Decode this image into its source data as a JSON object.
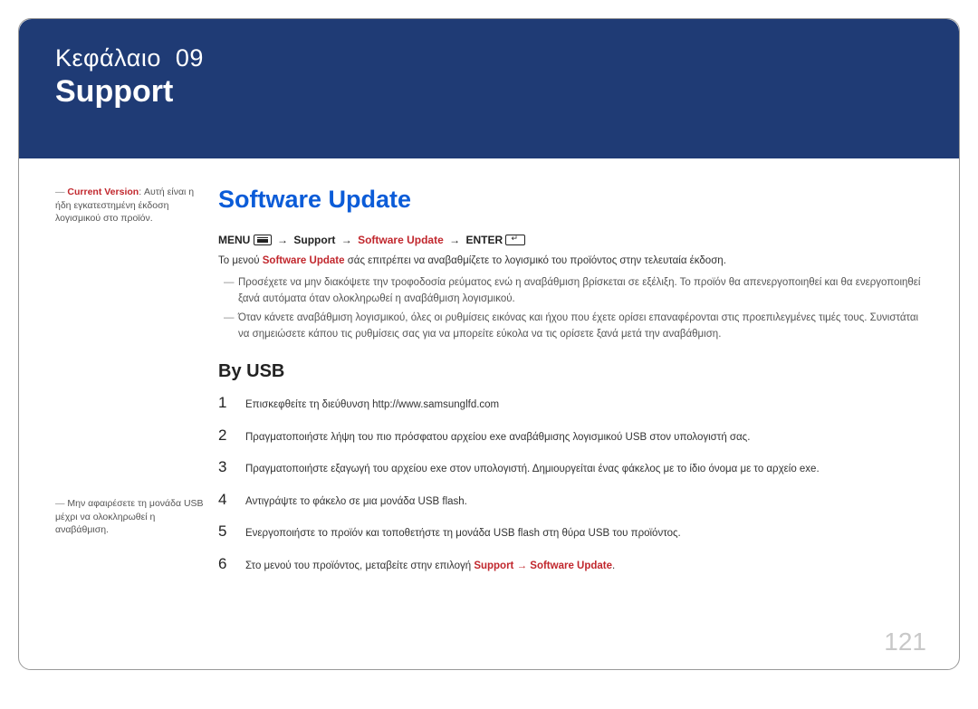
{
  "header": {
    "chapter_label": "Κεφάλαιο",
    "chapter_num": "09",
    "title": "Support"
  },
  "sidebar": {
    "note1_label": "Current Version",
    "note1_text": ": Αυτή είναι η ήδη εγκατεστημένη έκδοση λογισμικού στο προϊόν.",
    "note2_text": "Μην αφαιρέσετε τη μονάδα USB μέχρι να ολοκληρωθεί η αναβάθμιση."
  },
  "main": {
    "h1": "Software Update",
    "menu_label": "MENU",
    "support_label": "Support",
    "software_update_label": "Software Update",
    "enter_label": "ENTER",
    "intro_prefix": "Το μενού ",
    "intro_red": "Software Update",
    "intro_suffix": " σάς επιτρέπει να αναβαθμίζετε το λογισμικό του προϊόντος στην τελευταία έκδοση.",
    "dash1": "Προσέχετε να μην διακόψετε την τροφοδοσία ρεύματος ενώ η αναβάθμιση βρίσκεται σε εξέλιξη. Το προϊόν θα απενεργοποιηθεί και θα ενεργοποιηθεί ξανά αυτόματα όταν ολοκληρωθεί η αναβάθμιση λογισμικού.",
    "dash2": "Όταν κάνετε αναβάθμιση λογισμικού, όλες οι ρυθμίσεις εικόνας και ήχου που έχετε ορίσει επαναφέρονται στις προεπιλεγμένες τιμές τους. Συνιστάται να σημειώσετε κάπου τις ρυθμίσεις σας για να μπορείτε εύκολα να τις ορίσετε ξανά μετά την αναβάθμιση.",
    "h2": "By USB",
    "steps": [
      "Επισκεφθείτε τη διεύθυνση http://www.samsunglfd.com",
      "Πραγματοποιήστε λήψη του πιο πρόσφατου αρχείου exe αναβάθμισης λογισμικού USB στον υπολογιστή σας.",
      "Πραγματοποιήστε εξαγωγή του αρχείου exe στον υπολογιστή. Δημιουργείται ένας φάκελος με το ίδιο όνομα με το αρχείο exe.",
      "Αντιγράψτε το φάκελο σε μια μονάδα USB flash.",
      "Ενεργοποιήστε το προϊόν και τοποθετήστε τη μονάδα USB flash στη θύρα USB του προϊόντος."
    ],
    "step6_prefix": "Στο μενού του προϊόντος, μεταβείτε στην επιλογή ",
    "step6_support": "Support",
    "step6_arrow": " → ",
    "step6_sw": "Software Update",
    "step6_suffix": "."
  },
  "page_num": "121"
}
